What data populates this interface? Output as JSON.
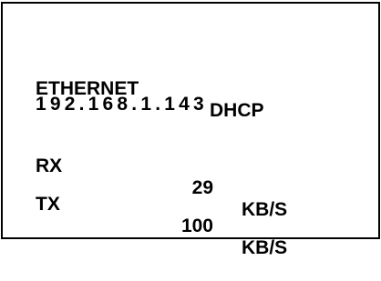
{
  "display": {
    "interface": "ETHERNET",
    "mode": "DHCP",
    "ip": "192.168.1.143",
    "rx": {
      "label": "RX",
      "value": "29",
      "unit": "KB/S"
    },
    "tx": {
      "label": "TX",
      "value": "100",
      "unit": "KB/S"
    }
  }
}
